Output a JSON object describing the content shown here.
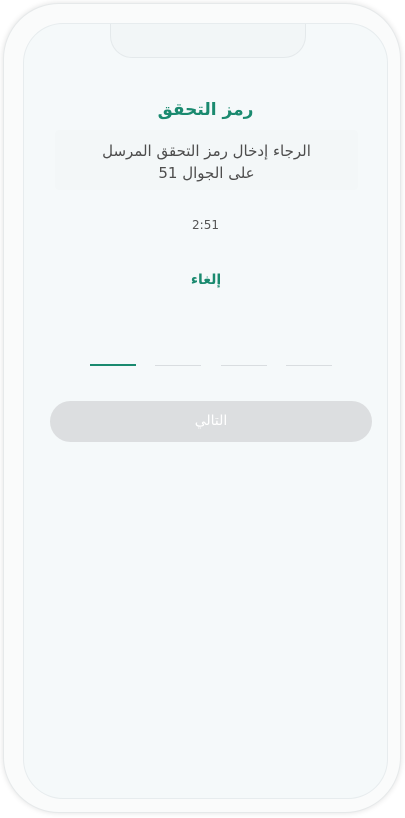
{
  "screen": {
    "title": "رمز التحقق",
    "message_line1": "الرجاء إدخال رمز التحقق المرسل",
    "message_line2": "على الجوال 51",
    "timer": "2:51",
    "cancel_label": "إلغاء",
    "otp": {
      "slots": 4,
      "active_index": 0
    },
    "next_label": "التالي"
  },
  "colors": {
    "accent": "#1a8a6f",
    "button_disabled": "#dcdee0",
    "screen_background": "#f5f9fa"
  }
}
